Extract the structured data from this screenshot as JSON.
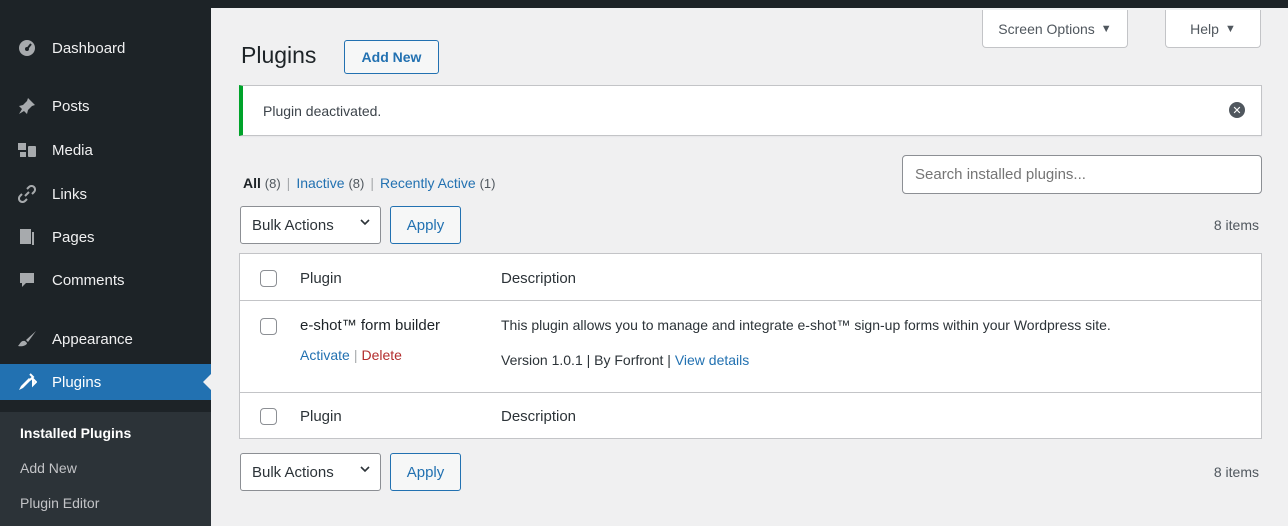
{
  "sidebar": {
    "items": [
      {
        "label": "Dashboard",
        "icon": "dashboard-icon"
      },
      {
        "label": "Posts",
        "icon": "pin-icon"
      },
      {
        "label": "Media",
        "icon": "media-icon"
      },
      {
        "label": "Links",
        "icon": "link-icon"
      },
      {
        "label": "Pages",
        "icon": "pages-icon"
      },
      {
        "label": "Comments",
        "icon": "comment-icon"
      },
      {
        "label": "Appearance",
        "icon": "brush-icon"
      },
      {
        "label": "Plugins",
        "icon": "plugin-icon"
      }
    ],
    "submenu": [
      "Installed Plugins",
      "Add New",
      "Plugin Editor"
    ]
  },
  "header": {
    "screen_options": "Screen Options",
    "help": "Help",
    "title": "Plugins",
    "add_new": "Add New"
  },
  "notice": {
    "text": "Plugin deactivated."
  },
  "filters": {
    "all": "All",
    "all_count": "(8)",
    "inactive": "Inactive",
    "inactive_count": "(8)",
    "recently_active": "Recently Active",
    "recently_active_count": "(1)",
    "separator": "|"
  },
  "search": {
    "placeholder": "Search installed plugins..."
  },
  "bulk": {
    "select": "Bulk Actions",
    "apply": "Apply",
    "items": "8 items"
  },
  "table": {
    "col_plugin": "Plugin",
    "col_description": "Description",
    "row": {
      "name": "e-shot™ form builder",
      "activate": "Activate",
      "delete": "Delete",
      "description": "This plugin allows you to manage and integrate e-shot™ sign-up forms within your Wordpress site.",
      "version": "Version 1.0.1 | By Forfront |",
      "view_details": "View details"
    }
  },
  "colors": {
    "accent": "#2271b1",
    "sidebar": "#1d2327",
    "success": "#00a32a",
    "delete": "#b32d2e"
  }
}
